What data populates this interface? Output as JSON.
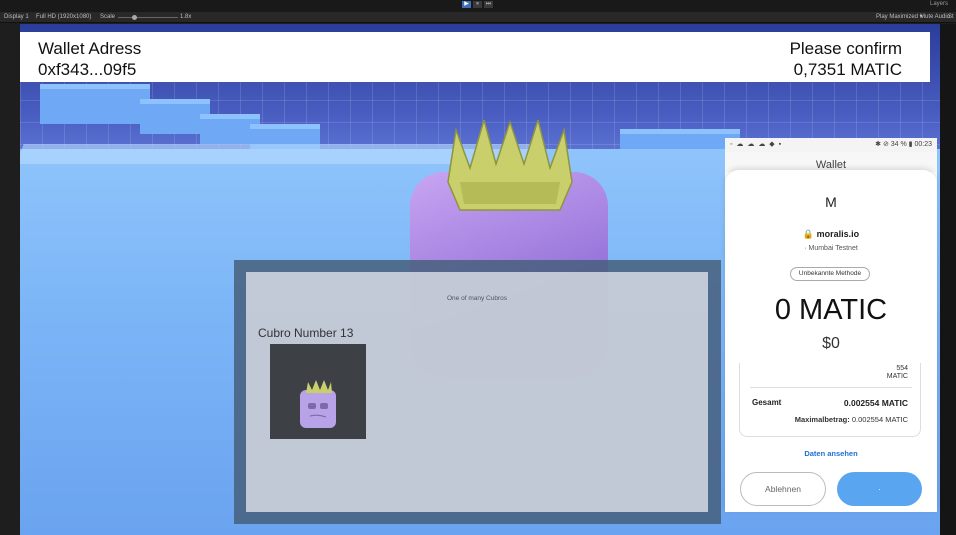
{
  "editor": {
    "play_icons": [
      "▶",
      "⏸",
      "⏭"
    ],
    "layers_label": "Layers",
    "display": "Display 1",
    "resolution": "Full HD (1920x1080)",
    "scale_label": "Scale",
    "scale_value": "1.8x",
    "play_mode": "Play Maximized ▾",
    "mute": "Mute Audio",
    "stats": "St"
  },
  "header": {
    "wallet_label": "Wallet Adress",
    "wallet_value": "0xf343...09f5",
    "confirm_label": "Please confirm",
    "confirm_value": "0,7351 MATIC"
  },
  "card": {
    "subtitle": "One of many Cubros",
    "title": "Cubro Number 13"
  },
  "wallet": {
    "status_left": "◦ ☁ ☁ ☁ ◆ ▪",
    "status_right": "✱ ⊘ 34 % ▮ 00:23",
    "behind_title": "Wallet",
    "logo": "M",
    "site": "🔒 moralis.io",
    "network": "· Mumbai Testnet",
    "method": "Unbekannte Methode",
    "amount": "0 MATIC",
    "usd": "$0",
    "fee_line1": "554",
    "fee_line2": "MATIC",
    "total_label": "Gesamt",
    "total_value": "0.002554 MATIC",
    "max_label": "Maximalbetrag:",
    "max_value": "0.002554 MATIC",
    "details_link": "Daten ansehen",
    "reject_label": "Ablehnen",
    "confirm_label": "·"
  },
  "colors": {
    "confirm_button": "#5aa5f0",
    "link": "#1f6fd6",
    "cube": "#9a78db",
    "crown": "#c9cf6a"
  }
}
